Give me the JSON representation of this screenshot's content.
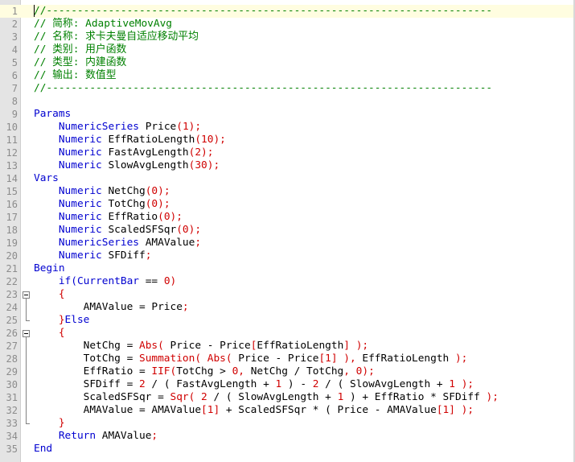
{
  "editor": {
    "lines": [
      {
        "num": "1",
        "current": true,
        "tokens": [
          {
            "t": "//------------------------------------------------------------------------",
            "c": "cm"
          }
        ]
      },
      {
        "num": "2",
        "tokens": [
          {
            "t": "// 简称: AdaptiveMovAvg",
            "c": "cm"
          }
        ]
      },
      {
        "num": "3",
        "tokens": [
          {
            "t": "// 名称: 求卡夫曼自适应移动平均",
            "c": "cm"
          }
        ]
      },
      {
        "num": "4",
        "tokens": [
          {
            "t": "// 类别: 用户函数",
            "c": "cm"
          }
        ]
      },
      {
        "num": "5",
        "tokens": [
          {
            "t": "// 类型: 内建函数",
            "c": "cm"
          }
        ]
      },
      {
        "num": "6",
        "tokens": [
          {
            "t": "// 输出: 数值型",
            "c": "cm"
          }
        ]
      },
      {
        "num": "7",
        "tokens": [
          {
            "t": "//------------------------------------------------------------------------",
            "c": "cm"
          }
        ]
      },
      {
        "num": "8",
        "tokens": []
      },
      {
        "num": "9",
        "tokens": [
          {
            "t": "Params",
            "c": "kw"
          }
        ]
      },
      {
        "num": "10",
        "tokens": [
          {
            "t": "    ",
            "c": "tx"
          },
          {
            "t": "NumericSeries",
            "c": "kw"
          },
          {
            "t": " Price",
            "c": "tx"
          },
          {
            "t": "(1);",
            "c": "nm"
          }
        ]
      },
      {
        "num": "11",
        "tokens": [
          {
            "t": "    ",
            "c": "tx"
          },
          {
            "t": "Numeric",
            "c": "kw"
          },
          {
            "t": " EffRatioLength",
            "c": "tx"
          },
          {
            "t": "(10);",
            "c": "nm"
          }
        ]
      },
      {
        "num": "12",
        "tokens": [
          {
            "t": "    ",
            "c": "tx"
          },
          {
            "t": "Numeric",
            "c": "kw"
          },
          {
            "t": " FastAvgLength",
            "c": "tx"
          },
          {
            "t": "(2);",
            "c": "nm"
          }
        ]
      },
      {
        "num": "13",
        "tokens": [
          {
            "t": "    ",
            "c": "tx"
          },
          {
            "t": "Numeric",
            "c": "kw"
          },
          {
            "t": " SlowAvgLength",
            "c": "tx"
          },
          {
            "t": "(30);",
            "c": "nm"
          }
        ]
      },
      {
        "num": "14",
        "tokens": [
          {
            "t": "Vars",
            "c": "kw"
          }
        ]
      },
      {
        "num": "15",
        "tokens": [
          {
            "t": "    ",
            "c": "tx"
          },
          {
            "t": "Numeric",
            "c": "kw"
          },
          {
            "t": " NetChg",
            "c": "tx"
          },
          {
            "t": "(0);",
            "c": "nm"
          }
        ]
      },
      {
        "num": "16",
        "tokens": [
          {
            "t": "    ",
            "c": "tx"
          },
          {
            "t": "Numeric",
            "c": "kw"
          },
          {
            "t": " TotChg",
            "c": "tx"
          },
          {
            "t": "(0);",
            "c": "nm"
          }
        ]
      },
      {
        "num": "17",
        "tokens": [
          {
            "t": "    ",
            "c": "tx"
          },
          {
            "t": "Numeric",
            "c": "kw"
          },
          {
            "t": " EffRatio",
            "c": "tx"
          },
          {
            "t": "(0);",
            "c": "nm"
          }
        ]
      },
      {
        "num": "18",
        "tokens": [
          {
            "t": "    ",
            "c": "tx"
          },
          {
            "t": "Numeric",
            "c": "kw"
          },
          {
            "t": " ScaledSFSqr",
            "c": "tx"
          },
          {
            "t": "(0);",
            "c": "nm"
          }
        ]
      },
      {
        "num": "19",
        "tokens": [
          {
            "t": "    ",
            "c": "tx"
          },
          {
            "t": "NumericSeries",
            "c": "kw"
          },
          {
            "t": " AMAValue",
            "c": "tx"
          },
          {
            "t": ";",
            "c": "nm"
          }
        ]
      },
      {
        "num": "20",
        "tokens": [
          {
            "t": "    ",
            "c": "tx"
          },
          {
            "t": "Numeric",
            "c": "kw"
          },
          {
            "t": " SFDiff",
            "c": "tx"
          },
          {
            "t": ";",
            "c": "nm"
          }
        ]
      },
      {
        "num": "21",
        "tokens": [
          {
            "t": "Begin",
            "c": "kw"
          }
        ]
      },
      {
        "num": "22",
        "tokens": [
          {
            "t": "    ",
            "c": "tx"
          },
          {
            "t": "if(",
            "c": "kw"
          },
          {
            "t": "CurrentBar",
            "c": "kw"
          },
          {
            "t": " == ",
            "c": "tx"
          },
          {
            "t": "0)",
            "c": "nm"
          }
        ]
      },
      {
        "num": "23",
        "tokens": [
          {
            "t": "    ",
            "c": "tx"
          },
          {
            "t": "{",
            "c": "nm"
          }
        ]
      },
      {
        "num": "24",
        "tokens": [
          {
            "t": "        AMAValue = Price",
            "c": "tx"
          },
          {
            "t": ";",
            "c": "nm"
          }
        ]
      },
      {
        "num": "25",
        "tokens": [
          {
            "t": "    ",
            "c": "tx"
          },
          {
            "t": "}",
            "c": "nm"
          },
          {
            "t": "Else",
            "c": "kw"
          }
        ]
      },
      {
        "num": "26",
        "tokens": [
          {
            "t": "    ",
            "c": "tx"
          },
          {
            "t": "{",
            "c": "nm"
          }
        ]
      },
      {
        "num": "27",
        "tokens": [
          {
            "t": "        NetChg = ",
            "c": "tx"
          },
          {
            "t": "Abs(",
            "c": "nm"
          },
          {
            "t": " Price - Price",
            "c": "tx"
          },
          {
            "t": "[",
            "c": "nm"
          },
          {
            "t": "EffRatioLength",
            "c": "tx"
          },
          {
            "t": "] );",
            "c": "nm"
          }
        ]
      },
      {
        "num": "28",
        "tokens": [
          {
            "t": "        TotChg = ",
            "c": "tx"
          },
          {
            "t": "Summation(",
            "c": "nm"
          },
          {
            "t": " ",
            "c": "tx"
          },
          {
            "t": "Abs(",
            "c": "nm"
          },
          {
            "t": " Price - Price",
            "c": "tx"
          },
          {
            "t": "[1] ),",
            "c": "nm"
          },
          {
            "t": " EffRatioLength ",
            "c": "tx"
          },
          {
            "t": ");",
            "c": "nm"
          }
        ]
      },
      {
        "num": "29",
        "tokens": [
          {
            "t": "        EffRatio = ",
            "c": "tx"
          },
          {
            "t": "IIF(",
            "c": "nm"
          },
          {
            "t": "TotChg > ",
            "c": "tx"
          },
          {
            "t": "0,",
            "c": "nm"
          },
          {
            "t": " NetChg / TotChg",
            "c": "tx"
          },
          {
            "t": ", 0);",
            "c": "nm"
          }
        ]
      },
      {
        "num": "30",
        "tokens": [
          {
            "t": "        SFDiff = ",
            "c": "tx"
          },
          {
            "t": "2",
            "c": "nm"
          },
          {
            "t": " / ( FastAvgLength + ",
            "c": "tx"
          },
          {
            "t": "1",
            "c": "nm"
          },
          {
            "t": " ) - ",
            "c": "tx"
          },
          {
            "t": "2",
            "c": "nm"
          },
          {
            "t": " / ( SlowAvgLength + ",
            "c": "tx"
          },
          {
            "t": "1",
            "c": "nm"
          },
          {
            "t": " );",
            "c": "nm"
          }
        ]
      },
      {
        "num": "31",
        "tokens": [
          {
            "t": "        ScaledSFSqr = ",
            "c": "tx"
          },
          {
            "t": "Sqr(",
            "c": "nm"
          },
          {
            "t": " ",
            "c": "tx"
          },
          {
            "t": "2",
            "c": "nm"
          },
          {
            "t": " / ( SlowAvgLength + ",
            "c": "tx"
          },
          {
            "t": "1",
            "c": "nm"
          },
          {
            "t": " ) + EffRatio * SFDiff ",
            "c": "tx"
          },
          {
            "t": ");",
            "c": "nm"
          }
        ]
      },
      {
        "num": "32",
        "tokens": [
          {
            "t": "        AMAValue = AMAValue",
            "c": "tx"
          },
          {
            "t": "[1]",
            "c": "nm"
          },
          {
            "t": " + ScaledSFSqr * ( Price - AMAValue",
            "c": "tx"
          },
          {
            "t": "[1]",
            "c": "nm"
          },
          {
            "t": " );",
            "c": "nm"
          }
        ]
      },
      {
        "num": "33",
        "tokens": [
          {
            "t": "    ",
            "c": "tx"
          },
          {
            "t": "}",
            "c": "nm"
          }
        ]
      },
      {
        "num": "34",
        "tokens": [
          {
            "t": "    ",
            "c": "tx"
          },
          {
            "t": "Return",
            "c": "kw"
          },
          {
            "t": " AMAValue",
            "c": "tx"
          },
          {
            "t": ";",
            "c": "nm"
          }
        ]
      },
      {
        "num": "35",
        "tokens": [
          {
            "t": "End",
            "c": "kw"
          }
        ]
      }
    ],
    "folds": [
      {
        "start": 23,
        "end": 25
      },
      {
        "start": 26,
        "end": 33
      }
    ]
  },
  "colors": {
    "comment": "#008000",
    "keyword": "#0000d0",
    "identifier": "#000000",
    "number_punct": "#d00000",
    "gutter": "#e4e4e4",
    "current_line": "#fffde0"
  }
}
